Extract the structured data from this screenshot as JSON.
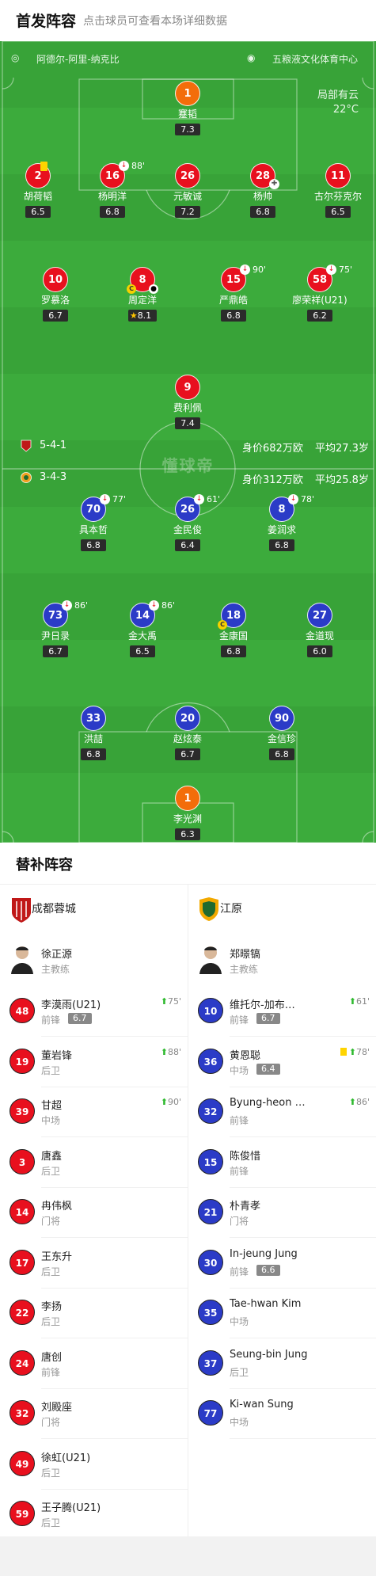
{
  "header": {
    "title": "首发阵容",
    "subtitle": "点击球员可查看本场详细数据"
  },
  "pitch": {
    "home_team": "阿德尔-阿里-纳克比",
    "venue": "五粮液文化体育中心",
    "weather": "局部有云",
    "temperature": "22°C",
    "watermark": "懂球帝",
    "home_formation": "5-4-1",
    "away_formation": "3-4-3",
    "home_value": "身价682万欧",
    "home_age": "平均27.3岁",
    "away_value": "身价312万欧",
    "away_age": "平均25.8岁"
  },
  "home_players": [
    {
      "num": "1",
      "name": "蹇韬",
      "rating": "7.3"
    },
    {
      "num": "2",
      "name": "胡荷韬",
      "rating": "6.5"
    },
    {
      "num": "16",
      "name": "杨明洋",
      "rating": "6.8",
      "sub": "88'"
    },
    {
      "num": "26",
      "name": "元敏诚",
      "rating": "7.2"
    },
    {
      "num": "28",
      "name": "杨帅",
      "rating": "6.8"
    },
    {
      "num": "11",
      "name": "古尔芬克尔",
      "rating": "6.5"
    },
    {
      "num": "10",
      "name": "罗慕洛",
      "rating": "6.7"
    },
    {
      "num": "8",
      "name": "周定洋",
      "rating": "8.1"
    },
    {
      "num": "15",
      "name": "严鼎皓",
      "rating": "6.8",
      "sub": "90'"
    },
    {
      "num": "58",
      "name": "廖荣祥(U21)",
      "rating": "6.2",
      "sub": "75'"
    },
    {
      "num": "9",
      "name": "费利佩",
      "rating": "7.4"
    }
  ],
  "away_players": [
    {
      "num": "70",
      "name": "具本哲",
      "rating": "6.8",
      "sub": "77'"
    },
    {
      "num": "26",
      "name": "金民俊",
      "rating": "6.4",
      "sub": "61'"
    },
    {
      "num": "8",
      "name": "姜润求",
      "rating": "6.8",
      "sub": "78'"
    },
    {
      "num": "73",
      "name": "尹日录",
      "rating": "6.7",
      "sub": "86'"
    },
    {
      "num": "14",
      "name": "金大禹",
      "rating": "6.5",
      "sub": "86'"
    },
    {
      "num": "18",
      "name": "金康国",
      "rating": "6.8"
    },
    {
      "num": "27",
      "name": "金道现",
      "rating": "6.0"
    },
    {
      "num": "33",
      "name": "洪喆",
      "rating": "6.8"
    },
    {
      "num": "20",
      "name": "赵炫泰",
      "rating": "6.7"
    },
    {
      "num": "90",
      "name": "金信珍",
      "rating": "6.8"
    },
    {
      "num": "1",
      "name": "李光渊",
      "rating": "6.3"
    }
  ],
  "subs": {
    "title": "替补阵容",
    "home_team": "成都蓉城",
    "away_team": "江原",
    "home_coach": {
      "name": "徐正源",
      "role": "主教练"
    },
    "away_coach": {
      "name": "郑暻镐",
      "role": "主教练"
    },
    "home": [
      {
        "num": "48",
        "name": "李漠雨(U21)",
        "pos": "前锋",
        "rating": "6.7",
        "time": "75'"
      },
      {
        "num": "19",
        "name": "董岩锋",
        "pos": "后卫",
        "time": "88'"
      },
      {
        "num": "39",
        "name": "甘超",
        "pos": "中场",
        "time": "90'"
      },
      {
        "num": "3",
        "name": "唐鑫",
        "pos": "后卫"
      },
      {
        "num": "14",
        "name": "冉伟枫",
        "pos": "门将"
      },
      {
        "num": "17",
        "name": "王东升",
        "pos": "后卫"
      },
      {
        "num": "22",
        "name": "李扬",
        "pos": "后卫"
      },
      {
        "num": "24",
        "name": "唐创",
        "pos": "前锋"
      },
      {
        "num": "32",
        "name": "刘殿座",
        "pos": "门将"
      },
      {
        "num": "49",
        "name": "徐虹(U21)",
        "pos": "后卫"
      },
      {
        "num": "59",
        "name": "王子腾(U21)",
        "pos": "后卫"
      }
    ],
    "away": [
      {
        "num": "10",
        "name": "维托尔-加布…",
        "pos": "前锋",
        "rating": "6.7",
        "time": "61'"
      },
      {
        "num": "36",
        "name": "黄恩聪",
        "pos": "中场",
        "rating": "6.4",
        "time": "78'"
      },
      {
        "num": "32",
        "name": "Byung-heon …",
        "pos": "前锋",
        "time": "86'"
      },
      {
        "num": "15",
        "name": "陈俊惜",
        "pos": "前锋"
      },
      {
        "num": "21",
        "name": "朴青孝",
        "pos": "门将"
      },
      {
        "num": "30",
        "name": "In-jeung Jung",
        "pos": "前锋",
        "rating": "6.6"
      },
      {
        "num": "35",
        "name": "Tae-hwan Kim",
        "pos": "中场"
      },
      {
        "num": "37",
        "name": "Seung-bin Jung",
        "pos": "后卫"
      },
      {
        "num": "77",
        "name": "Ki-wan Sung",
        "pos": "中场"
      }
    ]
  }
}
